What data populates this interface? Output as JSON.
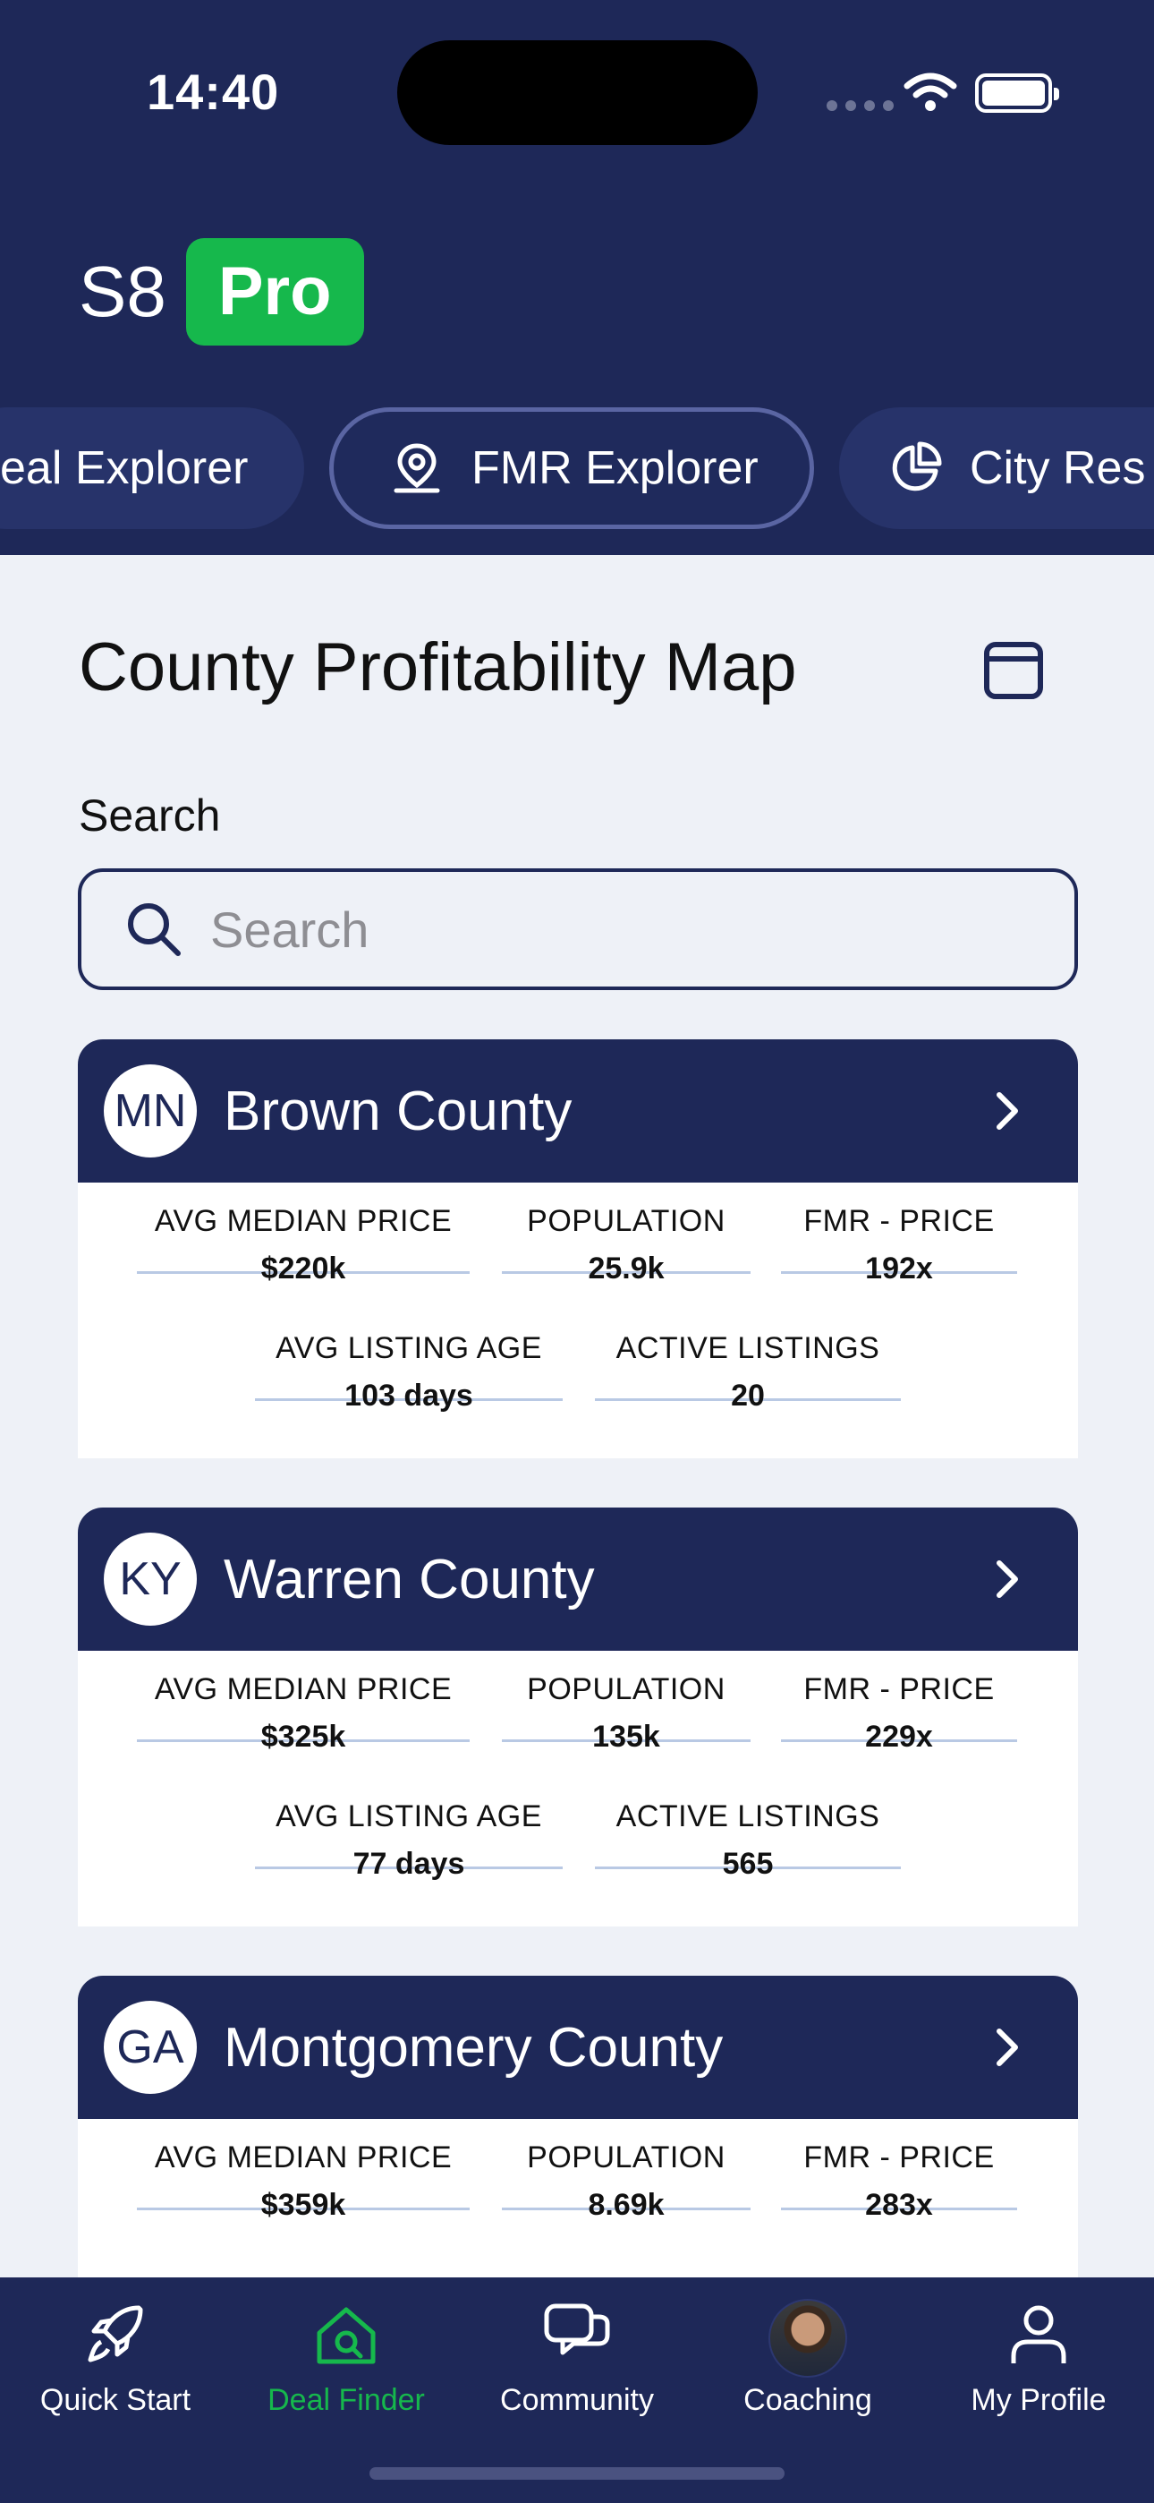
{
  "status_bar": {
    "time": "14:40"
  },
  "brand": {
    "name": "S8",
    "badge": "Pro",
    "badge_color": "#16b84c",
    "header_color": "#1e2858"
  },
  "nav_pills": [
    {
      "label": "eal Explorer",
      "icon": ""
    },
    {
      "label": "FMR Explorer",
      "icon": "map-pin-icon",
      "active": true
    },
    {
      "label": "City Res",
      "icon": "pie-chart-icon"
    }
  ],
  "page": {
    "title": "County Profitability Map",
    "search_label": "Search",
    "search_placeholder": "Search",
    "search_value": ""
  },
  "counties": [
    {
      "state": "MN",
      "name": "Brown County",
      "stats": [
        {
          "label": "AVG MEDIAN PRICE",
          "value": "$220k"
        },
        {
          "label": "POPULATION",
          "value": "25.9k"
        },
        {
          "label": "FMR - PRICE",
          "value": "192x"
        },
        {
          "label": "AVG LISTING AGE",
          "value": "103 days"
        },
        {
          "label": "ACTIVE LISTINGS",
          "value": "20"
        }
      ]
    },
    {
      "state": "KY",
      "name": "Warren County",
      "stats": [
        {
          "label": "AVG MEDIAN PRICE",
          "value": "$325k"
        },
        {
          "label": "POPULATION",
          "value": "135k"
        },
        {
          "label": "FMR - PRICE",
          "value": "229x"
        },
        {
          "label": "AVG LISTING AGE",
          "value": "77 days"
        },
        {
          "label": "ACTIVE LISTINGS",
          "value": "565"
        }
      ]
    },
    {
      "state": "GA",
      "name": "Montgomery County",
      "stats": [
        {
          "label": "AVG MEDIAN PRICE",
          "value": "$359k"
        },
        {
          "label": "POPULATION",
          "value": "8.69k"
        },
        {
          "label": "FMR - PRICE",
          "value": "283x"
        }
      ]
    }
  ],
  "tabbar": [
    {
      "label": "Quick Start",
      "icon": "rocket-icon"
    },
    {
      "label": "Deal Finder",
      "icon": "house-search-icon",
      "active": true
    },
    {
      "label": "Community",
      "icon": "chat-bubbles-icon"
    },
    {
      "label": "Coaching",
      "icon": "coach-avatar"
    },
    {
      "label": "My Profile",
      "icon": "user-icon"
    }
  ]
}
